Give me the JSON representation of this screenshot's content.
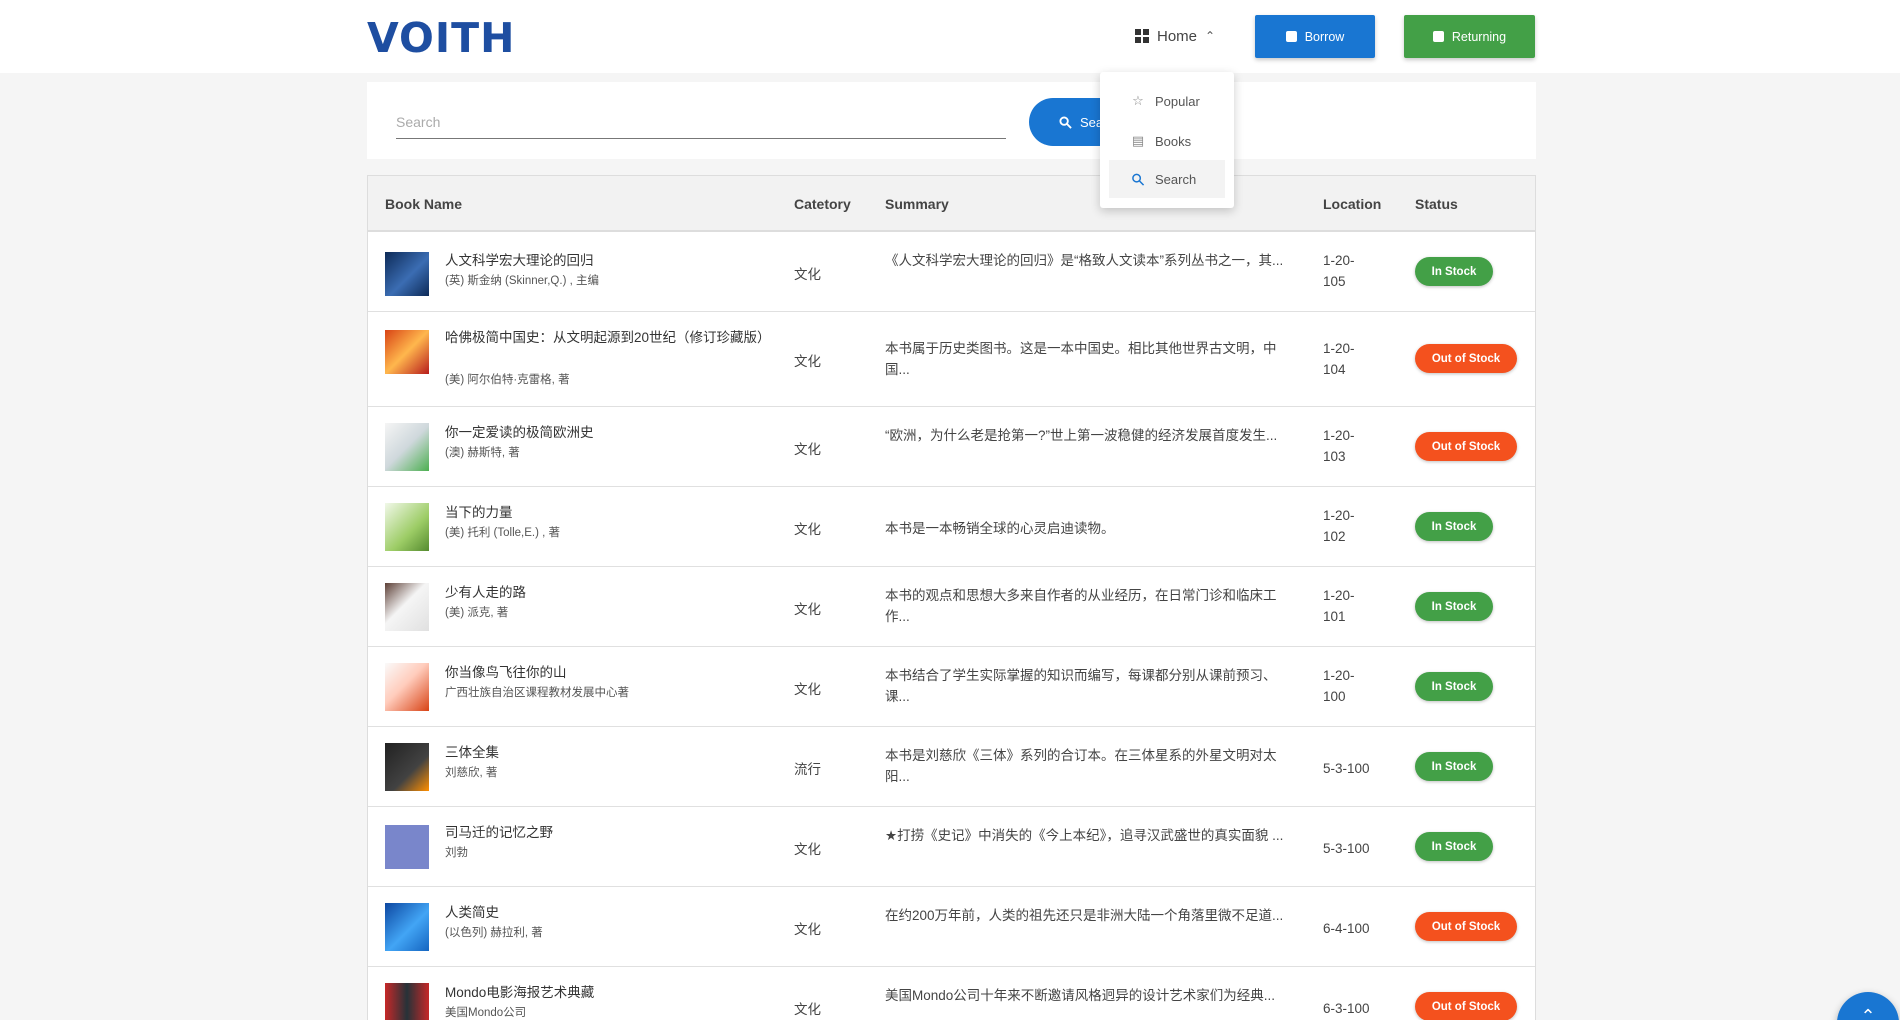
{
  "header": {
    "logo": "VOITH",
    "nav_home": "Home",
    "borrow": "Borrow",
    "returning": "Returning"
  },
  "dropdown": {
    "items": [
      {
        "label": "Popular",
        "icon": "star-icon"
      },
      {
        "label": "Books",
        "icon": "list-icon"
      },
      {
        "label": "Search",
        "icon": "search-icon"
      }
    ]
  },
  "search": {
    "placeholder": "Search",
    "button": "Search"
  },
  "table": {
    "headers": {
      "name": "Book Name",
      "category": "Catetory",
      "summary": "Summary",
      "location": "Location",
      "status": "Status"
    },
    "rows": [
      {
        "title": "人文科学宏大理论的回归",
        "author": "(英) 斯金纳 (Skinner,Q.) , 主编",
        "category": "文化",
        "summary": "《人文科学宏大理论的回归》是“格致人文读本”系列丛书之一，其...",
        "location": "1-20-105",
        "status": "In Stock"
      },
      {
        "title": "哈佛极简中国史：从文明起源到20世纪（修订珍藏版）",
        "author": "(美) 阿尔伯特·克雷格, 著",
        "category": "文化",
        "summary": "本书属于历史类图书。这是一本中国史。相比其他世界古文明，中国...",
        "location": "1-20-104",
        "status": "Out of Stock"
      },
      {
        "title": "你一定爱读的极简欧洲史",
        "author": "(澳) 赫斯特, 著",
        "category": "文化",
        "summary": "“欧洲，为什么老是抢第一?”世上第一波稳健的经济发展首度发生...",
        "location": "1-20-103",
        "status": "Out of Stock"
      },
      {
        "title": "当下的力量",
        "author": "(美) 托利 (Tolle,E.) , 著",
        "category": "文化",
        "summary": "本书是一本畅销全球的心灵启迪读物。",
        "location": "1-20-102",
        "status": "In Stock"
      },
      {
        "title": "少有人走的路",
        "author": "(美) 派克, 著",
        "category": "文化",
        "summary": "本书的观点和思想大多来自作者的从业经历，在日常门诊和临床工作...",
        "location": "1-20-101",
        "status": "In Stock"
      },
      {
        "title": "你当像鸟飞往你的山",
        "author": "广西壮族自治区课程教材发展中心著",
        "category": "文化",
        "summary": "本书结合了学生实际掌握的知识而编写，每课都分别从课前预习、课...",
        "location": "1-20-100",
        "status": "In Stock"
      },
      {
        "title": "三体全集",
        "author": "刘慈欣, 著",
        "category": "流行",
        "summary": "本书是刘慈欣《三体》系列的合订本。在三体星系的外星文明对太阳...",
        "location": "5-3-100",
        "status": "In Stock"
      },
      {
        "title": "司马迁的记忆之野",
        "author": "刘勃",
        "category": "文化",
        "summary": "★打捞《史记》中消失的《今上本纪》，追寻汉武盛世的真实面貌 ...",
        "location": "5-3-100",
        "status": "In Stock"
      },
      {
        "title": "人类简史",
        "author": "(以色列) 赫拉利, 著",
        "category": "文化",
        "summary": "在约200万年前，人类的祖先还只是非洲大陆一个角落里微不足道...",
        "location": "6-4-100",
        "status": "Out of Stock"
      },
      {
        "title": "Mondo电影海报艺术典藏",
        "author": "美国Mondo公司",
        "category": "文化",
        "summary": "美国Mondo公司十年来不断邀请风格迥异的设计艺术家们为经典...",
        "location": "6-3-100",
        "status": "Out of Stock"
      }
    ]
  },
  "colors": {
    "brand": "#1e4ea1",
    "primary": "#1976d2",
    "success": "#43a047",
    "danger": "#f4511e"
  }
}
